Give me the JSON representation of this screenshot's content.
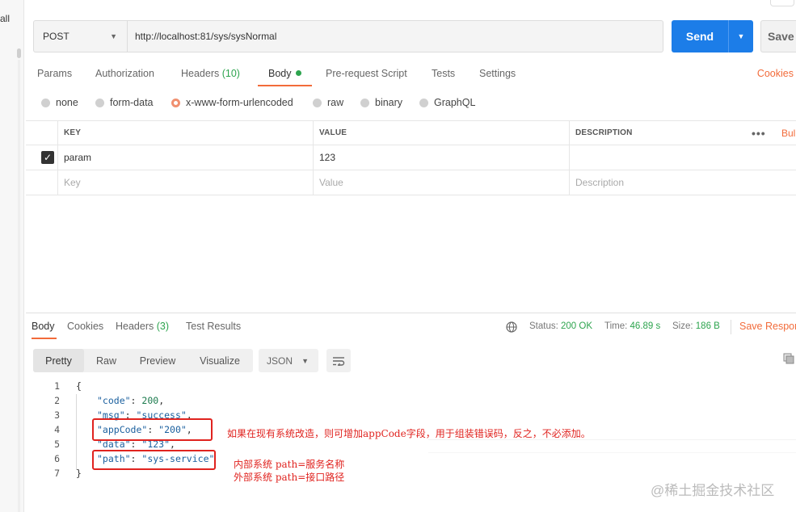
{
  "sidebar": {
    "partial_label": "all"
  },
  "request": {
    "method": "POST",
    "url": "http://localhost:81/sys/sysNormal",
    "send_label": "Send",
    "save_label": "Save"
  },
  "request_tabs": {
    "params": "Params",
    "authorization": "Authorization",
    "headers": "Headers",
    "headers_count": "(10)",
    "body": "Body",
    "pre_request": "Pre-request Script",
    "tests": "Tests",
    "settings": "Settings",
    "cookies": "Cookies"
  },
  "body_types": {
    "none": "none",
    "form_data": "form-data",
    "urlencoded": "x-www-form-urlencoded",
    "raw": "raw",
    "binary": "binary",
    "graphql": "GraphQL",
    "selected": "x-www-form-urlencoded"
  },
  "params_table": {
    "headers": {
      "key": "KEY",
      "value": "VALUE",
      "description": "DESCRIPTION",
      "more": "•••",
      "bulk": "Bul"
    },
    "row": {
      "key": "param",
      "value": "123",
      "description": "",
      "checked": true
    },
    "placeholders": {
      "key": "Key",
      "value": "Value",
      "description": "Description"
    }
  },
  "response_tabs": {
    "body": "Body",
    "cookies": "Cookies",
    "headers": "Headers",
    "headers_count": "(3)",
    "test_results": "Test Results"
  },
  "response_meta": {
    "status_label": "Status:",
    "status_value": "200 OK",
    "time_label": "Time:",
    "time_value": "46.89 s",
    "size_label": "Size:",
    "size_value": "186 B",
    "save_response": "Save Respor"
  },
  "view_modes": {
    "pretty": "Pretty",
    "raw": "Raw",
    "preview": "Preview",
    "visualize": "Visualize",
    "format": "JSON"
  },
  "response_body": {
    "line_numbers": [
      "1",
      "2",
      "3",
      "4",
      "5",
      "6",
      "7"
    ],
    "open": "{",
    "close": "}",
    "code_key": "\"code\"",
    "code_value": "200",
    "msg_key": "\"msg\"",
    "msg_value": "\"success\"",
    "appcode_key": "\"appCode\"",
    "appcode_value": "\"200\"",
    "data_key": "\"data\"",
    "data_value": "\"123\"",
    "path_key": "\"path\"",
    "path_value": "\"sys-service\""
  },
  "annotations": {
    "appcode_note": "如果在现有系统改造，则可增加appCode字段，用于组装错误码，反之，不必添加。",
    "path_note_1": "内部系统 path=服务名称",
    "path_note_2": "外部系统 path=接口路径"
  },
  "watermark": "@稀土掘金技术社区",
  "colors": {
    "accent": "#f26b3a",
    "send": "#1c7de8",
    "success": "#2da44e",
    "annotation": "#e0231f"
  }
}
